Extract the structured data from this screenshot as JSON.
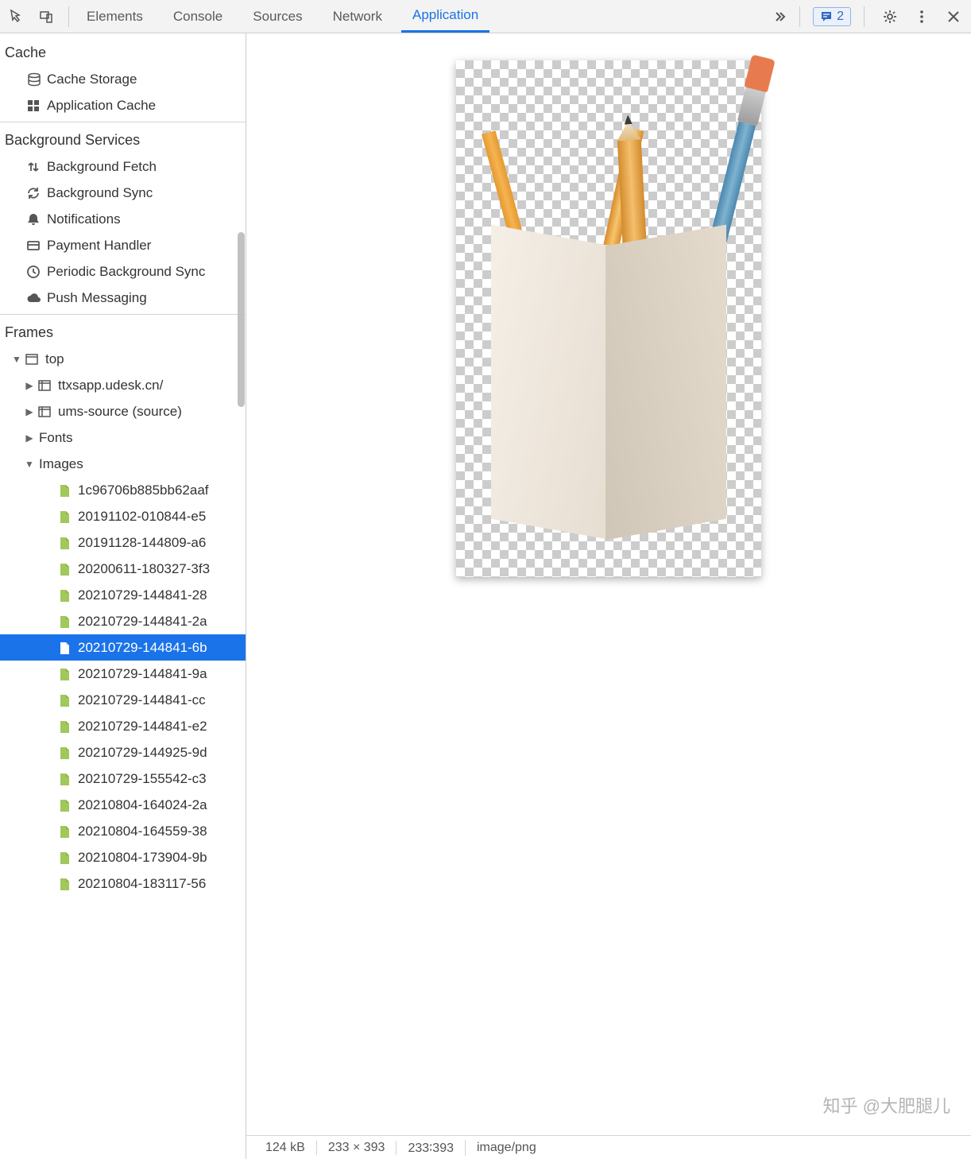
{
  "toolbar": {
    "tabs": [
      "Elements",
      "Console",
      "Sources",
      "Network",
      "Application"
    ],
    "active_tab": 4,
    "errors_count": "2"
  },
  "sidebar": {
    "sections": {
      "cache": {
        "title": "Cache",
        "items": [
          {
            "icon": "database",
            "label": "Cache Storage"
          },
          {
            "icon": "grid",
            "label": "Application Cache"
          }
        ]
      },
      "bgservices": {
        "title": "Background Services",
        "items": [
          {
            "icon": "updown",
            "label": "Background Fetch"
          },
          {
            "icon": "sync",
            "label": "Background Sync"
          },
          {
            "icon": "bell",
            "label": "Notifications"
          },
          {
            "icon": "card",
            "label": "Payment Handler"
          },
          {
            "icon": "clock",
            "label": "Periodic Background Sync"
          },
          {
            "icon": "cloud",
            "label": "Push Messaging"
          }
        ]
      },
      "frames": {
        "title": "Frames",
        "top_label": "top",
        "children": [
          {
            "icon": "frame",
            "label": "ttxsapp.udesk.cn/",
            "expanded": false
          },
          {
            "icon": "frame",
            "label": "ums-source (source)",
            "expanded": false
          },
          {
            "icon": "none",
            "label": "Fonts",
            "expanded": false
          },
          {
            "icon": "none",
            "label": "Images",
            "expanded": true
          }
        ],
        "images": [
          "1c96706b885bb62aaf",
          "20191102-010844-e5",
          "20191128-144809-a6",
          "20200611-180327-3f3",
          "20210729-144841-28",
          "20210729-144841-2a",
          "20210729-144841-6b",
          "20210729-144841-9a",
          "20210729-144841-cc",
          "20210729-144841-e2",
          "20210729-144925-9d",
          "20210729-155542-c3",
          "20210804-164024-2a",
          "20210804-164559-38",
          "20210804-173904-9b",
          "20210804-183117-56"
        ],
        "selected_index": 6
      }
    }
  },
  "status": {
    "size": "124 kB",
    "dimensions": "233 × 393",
    "ratio": "233∶393",
    "mime": "image/png"
  },
  "watermark": "知乎 @大肥腿儿"
}
